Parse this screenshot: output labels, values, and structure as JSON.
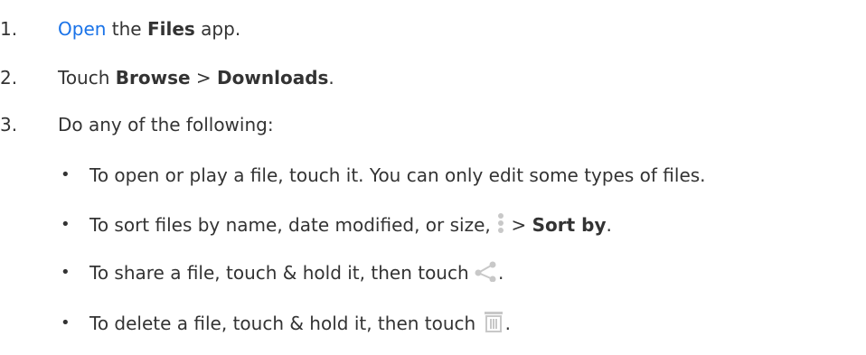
{
  "steps": [
    {
      "number": "1.",
      "link": "Open",
      "text_a": " the ",
      "bold": "Files",
      "text_b": " app."
    },
    {
      "number": "2.",
      "text_a": "Touch ",
      "bold_a": "Browse",
      "sep": " > ",
      "bold_b": "Downloads",
      "text_b": "."
    },
    {
      "number": "3.",
      "text": "Do any of the following:"
    }
  ],
  "bullets": [
    {
      "symbol": "•",
      "text": "To open or play a file, touch it. You can only edit some types of files."
    },
    {
      "symbol": "•",
      "text_a": "To sort files by name, date modified, or size, ",
      "icon": "more-vert-icon",
      "sep": " > ",
      "bold": "Sort by",
      "text_b": "."
    },
    {
      "symbol": "•",
      "text_a": "To share a file, touch & hold it, then touch ",
      "icon": "share-icon",
      "text_b": "."
    },
    {
      "symbol": "•",
      "text_a": "To delete a file, touch & hold it, then touch ",
      "icon": "trash-icon",
      "text_b": "."
    }
  ],
  "colors": {
    "text": "#333333",
    "link": "#1a73e8",
    "icon": "#c8c8c8"
  }
}
